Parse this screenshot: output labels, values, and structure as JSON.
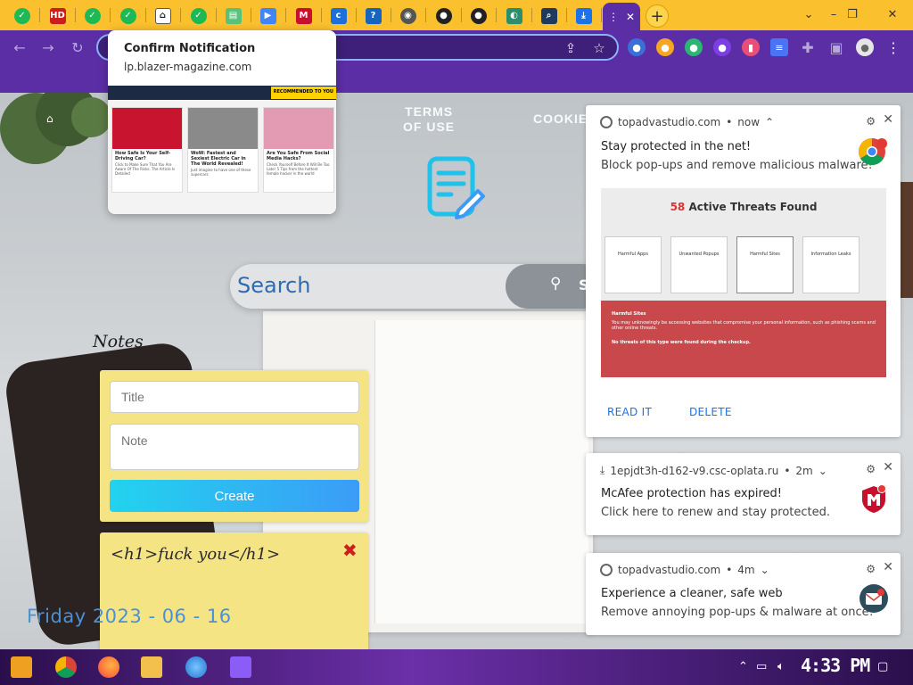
{
  "browser": {
    "tabs": [
      {
        "name": "tab-checkmark-1",
        "icon": "green-check-icon",
        "color": "#1db954"
      },
      {
        "name": "tab-hd",
        "icon": "hd-icon",
        "color": "#c81e1e"
      },
      {
        "name": "tab-checkmark-2",
        "icon": "green-check-icon",
        "color": "#1db954"
      },
      {
        "name": "tab-checkmark-3",
        "icon": "green-check-icon",
        "color": "#1db954"
      },
      {
        "name": "tab-home",
        "icon": "home-icon",
        "color": "#ffffff"
      },
      {
        "name": "tab-checkmark-4",
        "icon": "green-check-icon",
        "color": "#1db954"
      },
      {
        "name": "tab-doc",
        "icon": "document-icon",
        "color": "#58c27d"
      },
      {
        "name": "tab-play",
        "icon": "play-store-icon",
        "color": "#4285f4"
      },
      {
        "name": "tab-mcafee",
        "icon": "mcafee-icon",
        "color": "#c8102e"
      },
      {
        "name": "tab-c",
        "icon": "c-icon",
        "color": "#1e6fd9"
      },
      {
        "name": "tab-help",
        "icon": "question-icon",
        "color": "#1565c0"
      },
      {
        "name": "tab-globe",
        "icon": "globe-icon",
        "color": "#555555"
      },
      {
        "name": "tab-github-1",
        "icon": "github-icon",
        "color": "#222222"
      },
      {
        "name": "tab-github-2",
        "icon": "github-icon",
        "color": "#222222"
      },
      {
        "name": "tab-edge",
        "icon": "edge-icon",
        "color": "#2a8f6a"
      },
      {
        "name": "tab-search",
        "icon": "search-box-icon",
        "color": "#1f3a5f"
      },
      {
        "name": "tab-download",
        "icon": "download-icon",
        "color": "#1a73e8"
      }
    ],
    "active_tab_label": "⋮",
    "new_tab_label": "+",
    "window_controls": [
      "⌄",
      "–",
      "❐",
      "✕"
    ]
  },
  "confirm_popup": {
    "title": "Confirm Notification",
    "domain": "lp.blazer-magazine.com",
    "ad_badge": "RECOMMENDED TO YOU",
    "ad_items": [
      {
        "headline": "How Safe Is Your Self-Driving Car?",
        "body": "Click to Make Sure That You Are Aware Of The Risks. The Article Is Detailed"
      },
      {
        "headline": "WoW: Fastest and Sexiest Electric Car in The World Revealed!",
        "body": "Just imagine to have one of these supercars"
      },
      {
        "headline": "Are You Safe From Social Media Hacks?",
        "body": "Check Yourself Before It Will Be Too Late! 5 Tips from the hottest female hacker in the world"
      }
    ],
    "ad_colors": [
      "#c8142f",
      "#8a8a8a",
      "#e39bb3"
    ]
  },
  "page": {
    "nav_links": [
      "TERMS\nOF USE",
      "COOKIE"
    ],
    "search_placeholder": "Search",
    "search_button": "S",
    "notes_heading": "Notes",
    "form": {
      "title_placeholder": "Title",
      "note_placeholder": "Note",
      "create_label": "Create"
    },
    "saved_note": "<h1>fuck you</h1>",
    "delete_label": "✖",
    "date": "Friday 2023 - 06 - 16"
  },
  "notifications": [
    {
      "source": "topadvastudio.com",
      "time": "now",
      "title": "Stay protected in the net!",
      "body": "Block pop-ups and remove malicious malware!",
      "image": {
        "heading_count": "58",
        "heading_text": "Active Threats Found",
        "cards": [
          "Harmful Apps",
          "Unwanted Popups",
          "Harmful Sites",
          "Information Leaks"
        ],
        "panel_title": "Harmful Sites",
        "panel_text": "You may unknowingly be accessing websites that compromise your personal information, such as phishing scams and other online threats.",
        "panel_foot": "No threats of this type were found during the checkup."
      },
      "actions": [
        "READ IT",
        "DELETE"
      ]
    },
    {
      "source": "1epjdt3h-d162-v9.csc-oplata.ru",
      "time": "2m",
      "title": "McAfee protection has expired!",
      "body": "Click here to renew and stay protected."
    },
    {
      "source": "topadvastudio.com",
      "time": "4m",
      "title": "Experience a cleaner, safe web",
      "body": "Remove annoying pop-ups & malware at once!"
    }
  ],
  "taskbar": {
    "apps": [
      {
        "name": "start-button",
        "icon": "start-logo-icon",
        "color": "#f0a020"
      },
      {
        "name": "chrome-app",
        "icon": "chrome-icon",
        "color": "#4285f4"
      },
      {
        "name": "firefox-app",
        "icon": "firefox-icon",
        "color": "#ff7139"
      },
      {
        "name": "explorer-app",
        "icon": "folder-icon",
        "color": "#f3c04b"
      },
      {
        "name": "ie-app",
        "icon": "globe-icon",
        "color": "#1f78d1"
      },
      {
        "name": "visual-studio-app",
        "icon": "visual-studio-icon",
        "color": "#8b5cf6"
      }
    ],
    "clock": "4:33 PM"
  },
  "colors": {
    "tab_strip": "#fbc02d",
    "toolbar": "#5b2ea6",
    "note_yellow": "#f5e484",
    "accent_blue": "#1a73e8"
  }
}
